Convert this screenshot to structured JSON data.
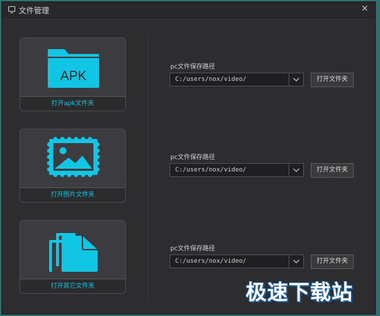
{
  "window": {
    "title": "文件管理",
    "close_label": "×"
  },
  "sections": [
    {
      "card_label": "打开apk文件夹",
      "icon": "apk-folder-icon",
      "icon_text": "APK",
      "path_label": "pc文件保存路径",
      "path_value": "C:/users/nox/video/",
      "button_label": "打开文件夹"
    },
    {
      "card_label": "打开图片文件夹",
      "icon": "picture-icon",
      "path_label": "pc文件保存路径",
      "path_value": "C:/users/nox/video/",
      "button_label": "打开文件夹"
    },
    {
      "card_label": "打开其它文件夹",
      "icon": "documents-icon",
      "path_label": "pc文件保存路径",
      "path_value": "C:/users/nox/video/",
      "button_label": "打开文件夹"
    }
  ],
  "watermark": "极速下载站",
  "colors": {
    "accent": "#11c6e4",
    "window_bg": "#2d2d30",
    "desktop_bg": "#2e6f72"
  }
}
